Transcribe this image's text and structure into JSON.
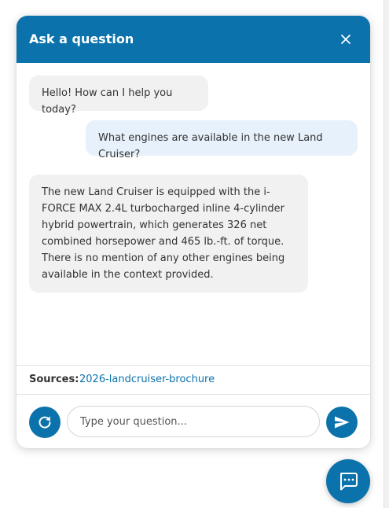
{
  "header": {
    "title": "Ask a question",
    "close_icon": "close-icon"
  },
  "messages": [
    {
      "role": "bot",
      "text": "Hello! How can I help you today?"
    },
    {
      "role": "user",
      "text": "What engines are available in the new Land Cruiser?"
    },
    {
      "role": "bot",
      "text": "The new Land Cruiser is equipped with the i-FORCE MAX 2.4L turbocharged inline 4-cylinder hybrid powertrain, which generates 326 net combined horsepower and 465 lb.-ft. of torque. There is no mention of any other engines being available in the context provided."
    }
  ],
  "sources": {
    "label": "Sources:",
    "items": [
      "2026-landcruiser-brochure"
    ]
  },
  "composer": {
    "placeholder": "Type your question...",
    "value": "",
    "refresh_icon": "refresh-icon",
    "send_icon": "send-icon"
  },
  "launcher": {
    "icon": "chat-bubble-icon"
  },
  "colors": {
    "primary": "#0b72ab",
    "bot_bubble": "#f1f1f1",
    "user_bubble": "#e7f1fb",
    "text": "#333333"
  }
}
